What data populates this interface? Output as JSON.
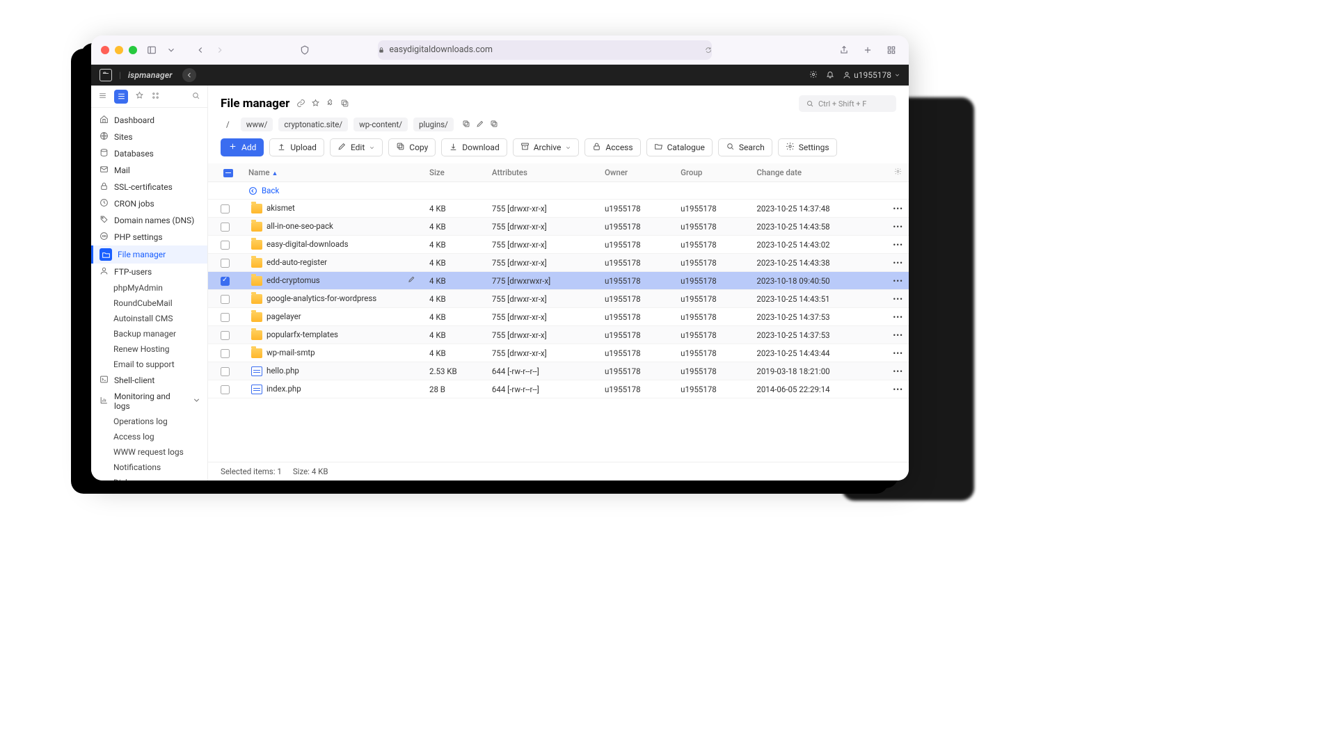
{
  "browser": {
    "address": "easydigitaldownloads.com"
  },
  "appbar": {
    "brand": "ispmanager",
    "user": "u1955178"
  },
  "sidebar_top": {},
  "sidebar": [
    {
      "id": "dashboard",
      "label": "Dashboard",
      "icon": "home"
    },
    {
      "id": "sites",
      "label": "Sites",
      "icon": "globe"
    },
    {
      "id": "databases",
      "label": "Databases",
      "icon": "db"
    },
    {
      "id": "mail",
      "label": "Mail",
      "icon": "mail"
    },
    {
      "id": "ssl",
      "label": "SSL-certificates",
      "icon": "lock"
    },
    {
      "id": "cron",
      "label": "CRON jobs",
      "icon": "clock"
    },
    {
      "id": "dns",
      "label": "Domain names (DNS)",
      "icon": "tag"
    },
    {
      "id": "php",
      "label": "PHP settings",
      "icon": "php"
    },
    {
      "id": "fm",
      "label": "File manager",
      "icon": "folder",
      "active": true
    },
    {
      "id": "ftp",
      "label": "FTP-users",
      "icon": "user"
    },
    {
      "id": "phpmyadmin",
      "label": "phpMyAdmin",
      "sub": true
    },
    {
      "id": "roundcube",
      "label": "RoundCubeMail",
      "sub": true
    },
    {
      "id": "autoinstall",
      "label": "Autoinstall CMS",
      "sub": true
    },
    {
      "id": "backup",
      "label": "Backup manager",
      "sub": true
    },
    {
      "id": "renew",
      "label": "Renew Hosting",
      "sub": true
    },
    {
      "id": "support",
      "label": "Email to support",
      "sub": true
    },
    {
      "id": "shell",
      "label": "Shell-client",
      "icon": "terminal"
    },
    {
      "id": "monitor",
      "label": "Monitoring and logs",
      "icon": "chart",
      "expandable": true
    },
    {
      "id": "oplog",
      "label": "Operations log",
      "sub": true
    },
    {
      "id": "accesslog",
      "label": "Access log",
      "sub": true
    },
    {
      "id": "wwwlog",
      "label": "WWW request logs",
      "sub": true
    },
    {
      "id": "notif",
      "label": "Notifications",
      "sub": true
    },
    {
      "id": "disk",
      "label": "Disk usage",
      "sub": true
    }
  ],
  "page": {
    "title": "File manager",
    "search_hint": "Ctrl + Shift + F"
  },
  "breadcrumbs": [
    "/",
    "www/",
    "cryptonatic.site/",
    "wp-content/",
    "plugins/"
  ],
  "toolbar": [
    {
      "id": "add",
      "label": "Add",
      "primary": true,
      "icon": "plus"
    },
    {
      "id": "upload",
      "label": "Upload",
      "icon": "upload"
    },
    {
      "id": "edit",
      "label": "Edit",
      "icon": "pencil",
      "dropdown": true
    },
    {
      "id": "copy",
      "label": "Copy",
      "icon": "copy"
    },
    {
      "id": "download",
      "label": "Download",
      "icon": "download"
    },
    {
      "id": "archive",
      "label": "Archive",
      "icon": "archive",
      "dropdown": true
    },
    {
      "id": "access",
      "label": "Access",
      "icon": "lock"
    },
    {
      "id": "catalogue",
      "label": "Catalogue",
      "icon": "folderopen"
    },
    {
      "id": "search",
      "label": "Search",
      "icon": "search"
    },
    {
      "id": "settings",
      "label": "Settings",
      "icon": "gear"
    }
  ],
  "columns": {
    "name": "Name",
    "size": "Size",
    "attributes": "Attributes",
    "owner": "Owner",
    "group": "Group",
    "change": "Change date"
  },
  "back_label": "Back",
  "files": [
    {
      "type": "folder",
      "name": "akismet",
      "size": "4 KB",
      "attr": "755 [drwxr-xr-x]",
      "owner": "u1955178",
      "group": "u1955178",
      "date": "2023-10-25 14:37:48"
    },
    {
      "type": "folder",
      "name": "all-in-one-seo-pack",
      "size": "4 KB",
      "attr": "755 [drwxr-xr-x]",
      "owner": "u1955178",
      "group": "u1955178",
      "date": "2023-10-25 14:43:58"
    },
    {
      "type": "folder",
      "name": "easy-digital-downloads",
      "size": "4 KB",
      "attr": "755 [drwxr-xr-x]",
      "owner": "u1955178",
      "group": "u1955178",
      "date": "2023-10-25 14:43:02"
    },
    {
      "type": "folder",
      "name": "edd-auto-register",
      "size": "4 KB",
      "attr": "755 [drwxr-xr-x]",
      "owner": "u1955178",
      "group": "u1955178",
      "date": "2023-10-25 14:43:38"
    },
    {
      "type": "folder",
      "name": "edd-cryptomus",
      "size": "4 KB",
      "attr": "775 [drwxrwxr-x]",
      "owner": "u1955178",
      "group": "u1955178",
      "date": "2023-10-18 09:40:50",
      "selected": true,
      "edit": true
    },
    {
      "type": "folder",
      "name": "google-analytics-for-wordpress",
      "size": "4 KB",
      "attr": "755 [drwxr-xr-x]",
      "owner": "u1955178",
      "group": "u1955178",
      "date": "2023-10-25 14:43:51"
    },
    {
      "type": "folder",
      "name": "pagelayer",
      "size": "4 KB",
      "attr": "755 [drwxr-xr-x]",
      "owner": "u1955178",
      "group": "u1955178",
      "date": "2023-10-25 14:37:53"
    },
    {
      "type": "folder",
      "name": "popularfx-templates",
      "size": "4 KB",
      "attr": "755 [drwxr-xr-x]",
      "owner": "u1955178",
      "group": "u1955178",
      "date": "2023-10-25 14:37:53"
    },
    {
      "type": "folder",
      "name": "wp-mail-smtp",
      "size": "4 KB",
      "attr": "755 [drwxr-xr-x]",
      "owner": "u1955178",
      "group": "u1955178",
      "date": "2023-10-25 14:43:44"
    },
    {
      "type": "file",
      "name": "hello.php",
      "size": "2.53 KB",
      "attr": "644 [-rw-r--r--]",
      "owner": "u1955178",
      "group": "u1955178",
      "date": "2019-03-18 18:21:00"
    },
    {
      "type": "file",
      "name": "index.php",
      "size": "28 B",
      "attr": "644 [-rw-r--r--]",
      "owner": "u1955178",
      "group": "u1955178",
      "date": "2014-06-05 22:29:14"
    }
  ],
  "status": {
    "selected_label": "Selected items:",
    "selected_count": "1",
    "size_label": "Size:",
    "size_value": "4 KB"
  }
}
